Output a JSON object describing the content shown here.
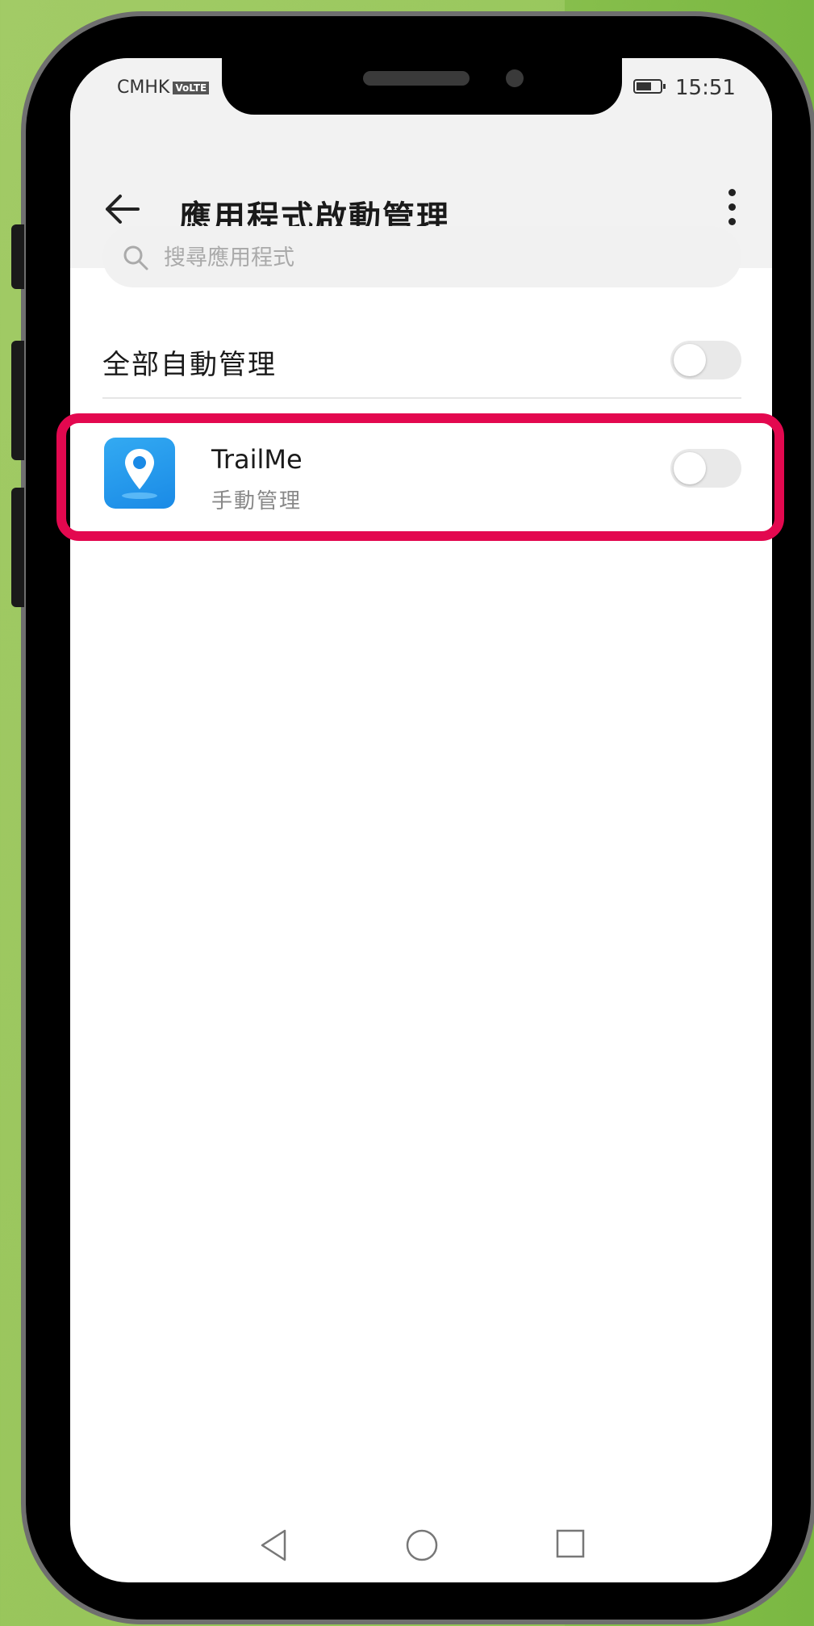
{
  "status_bar": {
    "carrier": "CMHK",
    "volte": "VoLTE",
    "signal": ".",
    "time": "15:51"
  },
  "header": {
    "title": "應用程式啟動管理",
    "back_icon": "arrow-left-icon",
    "menu_icon": "more-vert-icon"
  },
  "search": {
    "placeholder": "搜尋應用程式",
    "icon": "search-icon"
  },
  "auto_manage_all": {
    "label": "全部自動管理",
    "enabled": false
  },
  "apps": [
    {
      "name": "TrailMe",
      "status": "手動管理",
      "icon": "map-pin-icon",
      "auto_manage": false
    }
  ],
  "nav_bar": {
    "back_icon": "triangle-back-icon",
    "home_icon": "circle-home-icon",
    "recent_icon": "square-recent-icon"
  },
  "colors": {
    "highlight": "#e3084f",
    "app_icon_blue": "#1a8ae6",
    "background_green": "#8bc04f"
  }
}
